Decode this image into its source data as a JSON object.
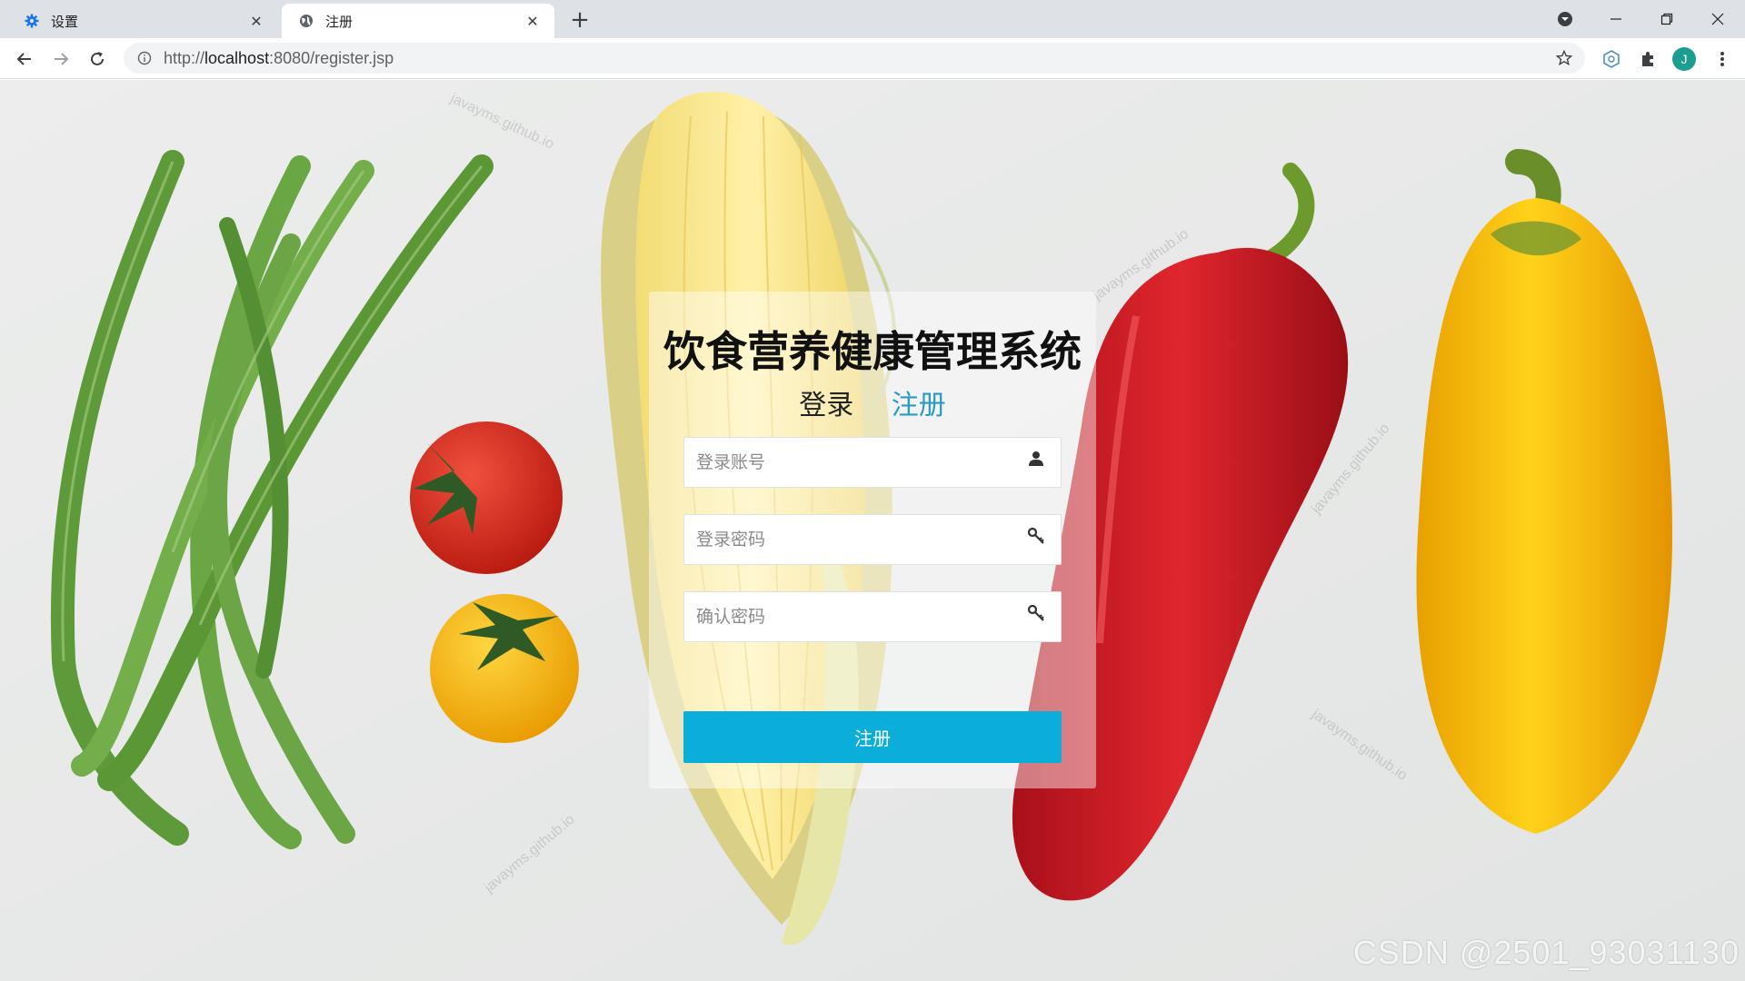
{
  "browser": {
    "tabs": [
      {
        "title": "设置",
        "icon": "gear-icon",
        "active": false
      },
      {
        "title": "注册",
        "icon": "globe-icon",
        "active": true
      }
    ],
    "url": {
      "scheme": "http://",
      "host": "localhost",
      "path": ":8080/register.jsp"
    },
    "profile_initial": "J"
  },
  "form": {
    "system_title": "饮食营养健康管理系统",
    "tab_login": "登录",
    "tab_register": "注册",
    "fields": {
      "account_placeholder": "登录账号",
      "password_placeholder": "登录密码",
      "confirm_placeholder": "确认密码"
    },
    "submit_label": "注册"
  },
  "watermarks": {
    "text": "javayms.github.io"
  },
  "footer_watermark": "CSDN @2501_93031130",
  "colors": {
    "accent": "#0badd9",
    "tab_active_text": "#2a9bc1"
  }
}
